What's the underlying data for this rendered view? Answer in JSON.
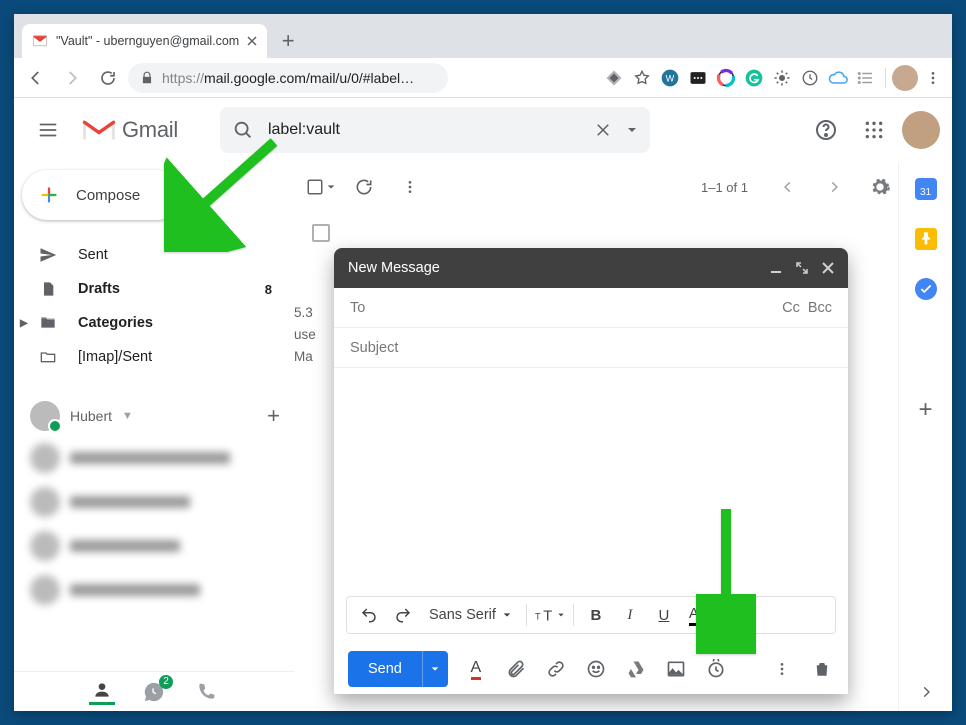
{
  "window": {
    "tab_title": "\"Vault\" - ubernguyen@gmail.com"
  },
  "browser": {
    "url_scheme": "https://",
    "url_rest": "mail.google.com/mail/u/0/#label…"
  },
  "header": {
    "logo_text": "Gmail",
    "search_value": "label:vault"
  },
  "sidebar": {
    "compose_label": "Compose",
    "items": [
      {
        "icon": "sent",
        "label": "Sent",
        "bold": false
      },
      {
        "icon": "drafts",
        "label": "Drafts",
        "bold": true,
        "count": "8"
      },
      {
        "icon": "categories",
        "label": "Categories",
        "bold": true,
        "caret": true
      },
      {
        "icon": "folder",
        "label": "[Imap]/Sent",
        "bold": false
      }
    ],
    "hangouts_user": "Hubert",
    "hangouts_badge": "2"
  },
  "mail_toolbar": {
    "range": "1–1 of 1"
  },
  "peek_lines": [
    "5.3",
    "use",
    "Ma"
  ],
  "compose": {
    "title": "New Message",
    "to_label": "To",
    "cc_label": "Cc",
    "bcc_label": "Bcc",
    "subject_placeholder": "Subject",
    "font_name": "Sans Serif",
    "send_label": "Send"
  },
  "rightbar": {
    "calendar_day": "31"
  }
}
